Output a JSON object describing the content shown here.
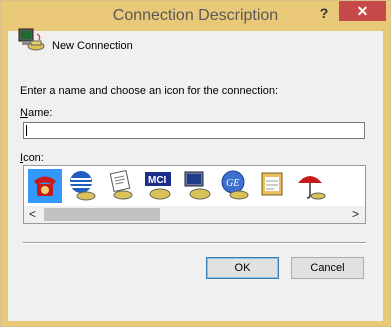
{
  "window": {
    "title": "Connection Description",
    "help_glyph": "?",
    "close_glyph": "✕"
  },
  "header": {
    "label": "New Connection"
  },
  "prompt": "Enter a name and choose an icon for the connection:",
  "name_field": {
    "label_u": "N",
    "label_rest": "ame:",
    "value": ""
  },
  "icon_field": {
    "label_u": "I",
    "label_rest": "con:"
  },
  "icons": [
    {
      "name": "red-telephone-icon",
      "selected": true
    },
    {
      "name": "globe-telephone-icon",
      "selected": false
    },
    {
      "name": "document-telephone-icon",
      "selected": false
    },
    {
      "name": "mci-telephone-icon",
      "selected": false
    },
    {
      "name": "computer-telephone-icon",
      "selected": false
    },
    {
      "name": "ge-telephone-icon",
      "selected": false
    },
    {
      "name": "calendar-telephone-icon",
      "selected": false
    },
    {
      "name": "umbrella-telephone-icon",
      "selected": false
    }
  ],
  "scroll": {
    "left_glyph": "<",
    "right_glyph": ">"
  },
  "buttons": {
    "ok": "OK",
    "cancel": "Cancel"
  },
  "colors": {
    "frame": "#e9c877",
    "close": "#c74a4a",
    "selection": "#3399ff"
  }
}
